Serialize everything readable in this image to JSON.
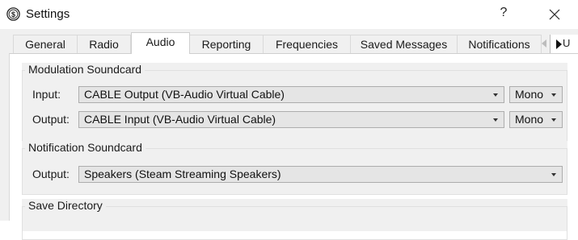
{
  "window": {
    "title": "Settings",
    "help_glyph": "?",
    "app_icon": "dollar-circle-icon",
    "close_icon": "close-icon"
  },
  "tabs": [
    {
      "label": "General"
    },
    {
      "label": "Radio"
    },
    {
      "label": "Audio",
      "selected": true
    },
    {
      "label": "Reporting"
    },
    {
      "label": "Frequencies"
    },
    {
      "label": "Saved Messages"
    },
    {
      "label": "Notifications"
    }
  ],
  "tab_scroll": {
    "left_icon": "triangle-left-icon",
    "right_icon": "triangle-right-icon",
    "overflow_text": "U"
  },
  "modulation": {
    "title": "Modulation Soundcard",
    "input_label": "Input:",
    "input_value": "CABLE Output (VB-Audio Virtual Cable)",
    "input_channel": "Mono",
    "output_label": "Output:",
    "output_value": "CABLE Input (VB-Audio Virtual Cable)",
    "output_channel": "Mono"
  },
  "notification": {
    "title": "Notification Soundcard",
    "output_label": "Output:",
    "output_value": "Speakers (Steam Streaming Speakers)"
  },
  "save_directory": {
    "title": "Save Directory"
  },
  "colors": {
    "dialog_bg": "#f0f0f0",
    "combo_bg": "#e5e5e5",
    "combo_border": "#adadad"
  }
}
